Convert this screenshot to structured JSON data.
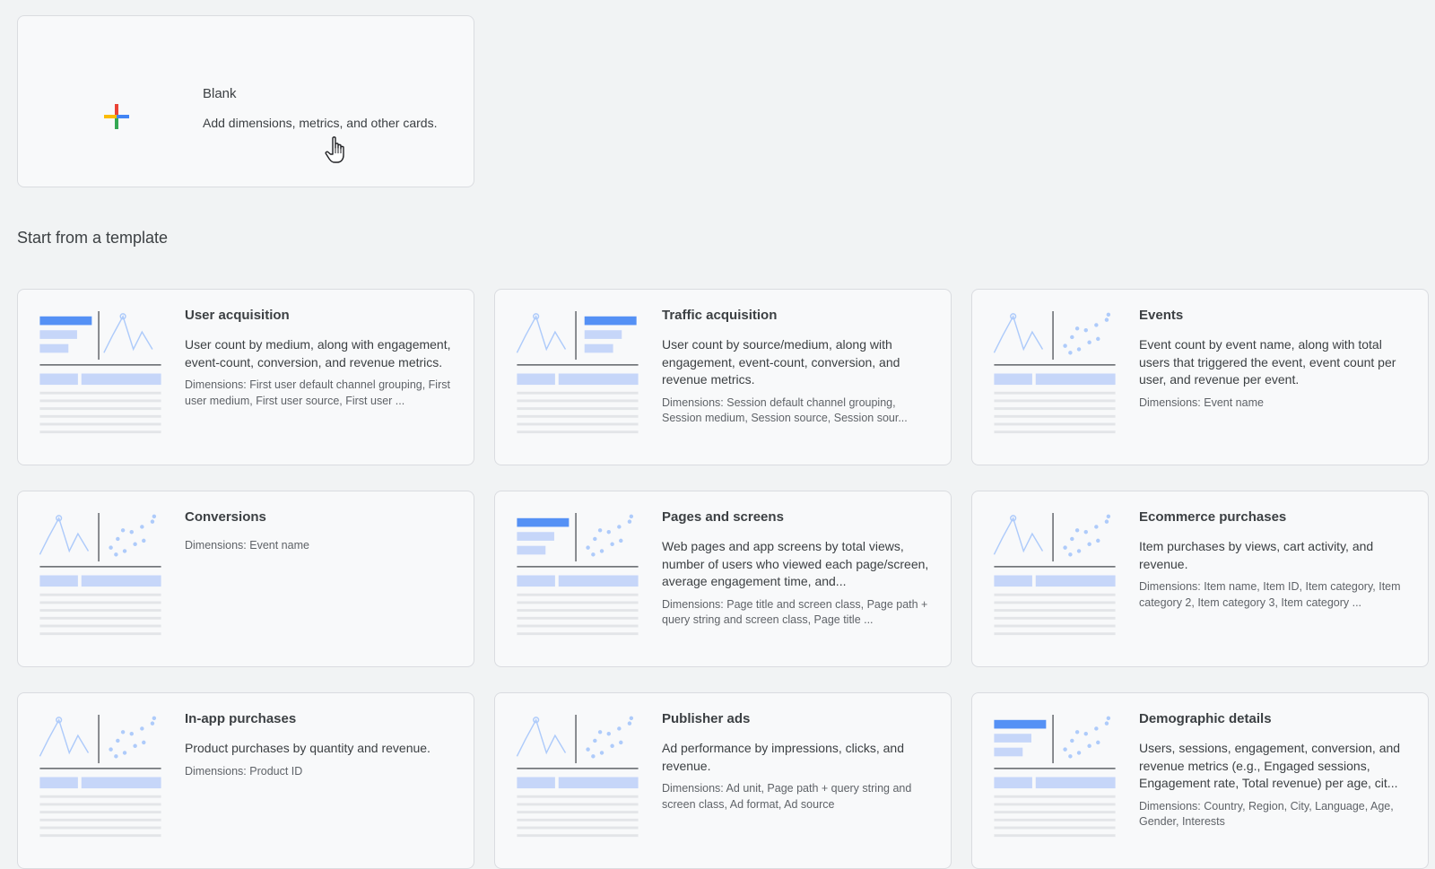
{
  "blank": {
    "title": "Blank",
    "description": "Add dimensions, metrics, and other cards."
  },
  "section_title": "Start from a template",
  "templates": [
    {
      "title": "User acquisition",
      "thumb": "bars-line",
      "description": "User count by medium, along with engagement, event-count, conversion, and revenue metrics.",
      "dimensions": "Dimensions: First user default channel grouping, First user medium, First user source, First user ..."
    },
    {
      "title": "Traffic acquisition",
      "thumb": "line-bars",
      "description": "User count by source/medium, along with engagement, event-count, conversion, and revenue metrics.",
      "dimensions": "Dimensions: Session default channel grouping, Session medium, Session source, Session sour..."
    },
    {
      "title": "Events",
      "thumb": "line-scatter",
      "description": "Event count by event name, along with total users that triggered the event, event count per user, and revenue per event.",
      "dimensions": "Dimensions: Event name"
    },
    {
      "title": "Conversions",
      "thumb": "line-scatter",
      "description": "",
      "dimensions": "Dimensions: Event name"
    },
    {
      "title": "Pages and screens",
      "thumb": "bars-scatter",
      "description": "Web pages and app screens by total views, number of users who viewed each page/screen, average engagement time, and...",
      "dimensions": "Dimensions: Page title and screen class, Page path + query string and screen class, Page title ..."
    },
    {
      "title": "Ecommerce purchases",
      "thumb": "line-scatter",
      "description": "Item purchases by views, cart activity, and revenue.",
      "dimensions": "Dimensions: Item name, Item ID, Item category, Item category 2, Item category 3, Item category ..."
    },
    {
      "title": "In-app purchases",
      "thumb": "line-scatter",
      "description": "Product purchases by quantity and revenue.",
      "dimensions": "Dimensions: Product ID"
    },
    {
      "title": "Publisher ads",
      "thumb": "line-scatter",
      "description": "Ad performance by impressions, clicks, and revenue.",
      "dimensions": "Dimensions: Ad unit, Page path + query string and screen class, Ad format, Ad source"
    },
    {
      "title": "Demographic details",
      "thumb": "bars-scatter",
      "description": "Users, sessions, engagement, conversion, and revenue metrics (e.g., Engaged sessions, Engagement rate, Total revenue) per age, cit...",
      "dimensions": "Dimensions: Country, Region, City, Language, Age, Gender, Interests"
    }
  ],
  "colors": {
    "bar_blue": "#4285f4",
    "bar_light": "#c6d6f9",
    "line_blue": "#aecbfa",
    "plus_blue": "#4285f4",
    "plus_red": "#ea4335",
    "plus_yellow": "#fbbc04",
    "plus_green": "#34a853"
  }
}
